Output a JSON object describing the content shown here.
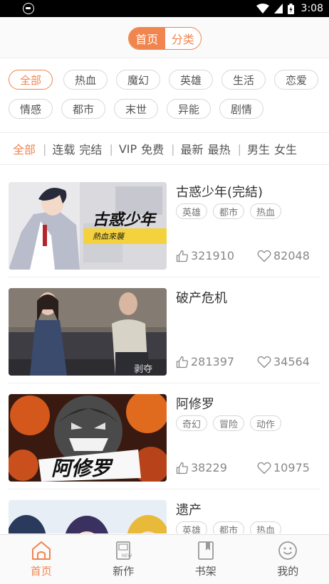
{
  "status_bar": {
    "time": "3:08"
  },
  "header": {
    "tab_home": "首页",
    "tab_category": "分类"
  },
  "genre_tags": [
    "全部",
    "热血",
    "魔幻",
    "英雄",
    "生活",
    "恋爱",
    "情感",
    "都市",
    "末世",
    "异能",
    "剧情"
  ],
  "filters": {
    "all": "全部",
    "serial": "连载",
    "finished": "完结",
    "vip": "VIP",
    "free": "免费",
    "newest": "最新",
    "hottest": "最热",
    "male": "男生",
    "female": "女生"
  },
  "comics": [
    {
      "title": "古惑少年(完結)",
      "tags": [
        "英雄",
        "都市",
        "热血"
      ],
      "likes": "321910",
      "favorites": "82048",
      "cover_text": "古惑少年",
      "cover_subtext": "熱血來襲"
    },
    {
      "title": "破产危机",
      "tags": [],
      "likes": "281397",
      "favorites": "34564",
      "cover_text": "剥夺"
    },
    {
      "title": "阿修罗",
      "tags": [
        "奇幻",
        "冒险",
        "动作"
      ],
      "likes": "38229",
      "favorites": "10975",
      "cover_text": "阿修罗"
    },
    {
      "title": "遗产",
      "tags": [
        "英雄",
        "都市",
        "热血"
      ]
    }
  ],
  "bottom_nav": {
    "home": "首页",
    "new": "新作",
    "shelf": "书架",
    "mine": "我的"
  },
  "colors": {
    "accent": "#f0854f",
    "status_bar": "#000000"
  }
}
